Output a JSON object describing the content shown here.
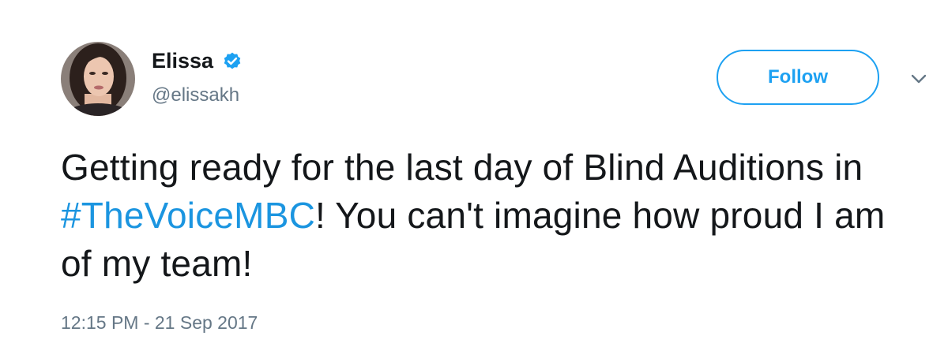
{
  "user": {
    "display_name": "Elissa",
    "handle": "@elissakh",
    "verified": true
  },
  "actions": {
    "follow_label": "Follow"
  },
  "tweet": {
    "text_before": "Getting ready for the last day of Blind Auditions in ",
    "hashtag": "#TheVoiceMBC",
    "text_after": "! You can't imagine how proud I am of my team!",
    "timestamp": "12:15 PM - 21 Sep 2017"
  },
  "colors": {
    "link": "#1b95e0",
    "accent": "#1da1f2",
    "secondary_text": "#657786",
    "primary_text": "#14171a"
  },
  "icons": {
    "verified": "verified-badge-icon",
    "menu": "chevron-down-icon"
  }
}
